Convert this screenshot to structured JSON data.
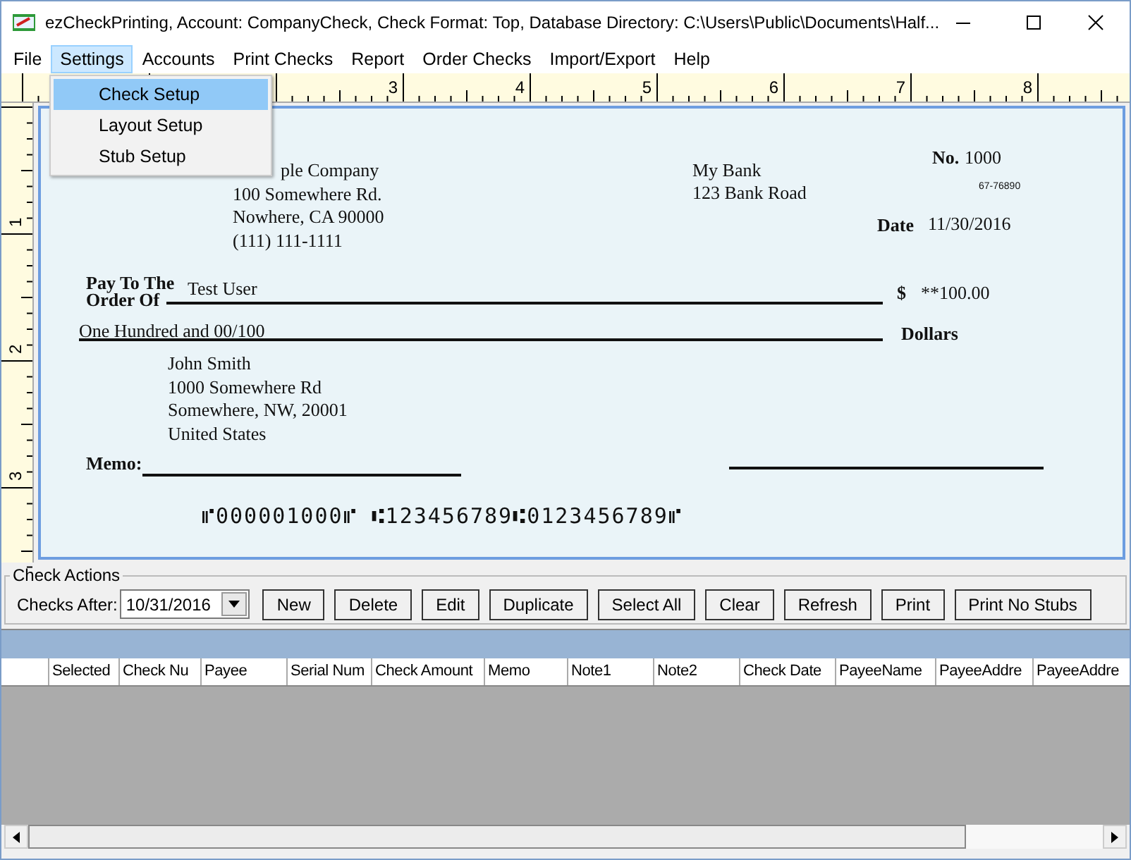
{
  "window": {
    "title": "ezCheckPrinting, Account: CompanyCheck, Check Format: Top, Database Directory: C:\\Users\\Public\\Documents\\Half..."
  },
  "menu": [
    {
      "label": "File",
      "selected": false
    },
    {
      "label": "Settings",
      "selected": true
    },
    {
      "label": "Accounts",
      "selected": false
    },
    {
      "label": "Print Checks",
      "selected": false
    },
    {
      "label": "Report",
      "selected": false
    },
    {
      "label": "Order Checks",
      "selected": false
    },
    {
      "label": "Import/Export",
      "selected": false
    },
    {
      "label": "Help",
      "selected": false
    }
  ],
  "settings_menu": [
    {
      "label": "Check Setup",
      "selected": true
    },
    {
      "label": "Layout Setup",
      "selected": false
    },
    {
      "label": "Stub Setup",
      "selected": false
    }
  ],
  "ruler": {
    "horizontal_labels": [
      "3",
      "4",
      "5",
      "6",
      "7",
      "8"
    ],
    "vertical_labels": [
      "1",
      "2",
      "3"
    ]
  },
  "check": {
    "company_lines": [
      "ple Company",
      "100 Somewhere Rd.",
      "Nowhere, CA 90000",
      "(111) 111-1111"
    ],
    "bank_lines": [
      "My Bank",
      "123 Bank Road"
    ],
    "number_label": "No.",
    "number": "1000",
    "routing": "67-76890",
    "date_label": "Date",
    "date": "11/30/2016",
    "pay_to_label": [
      "Pay To The",
      "Order Of"
    ],
    "payee": "Test User",
    "dollar_sign": "$",
    "amount": "**100.00",
    "amount_words": "One Hundred  and 00/100",
    "dollars_label": "Dollars",
    "address_lines": [
      "John Smith",
      "1000 Somewhere Rd",
      "Somewhere, NW, 20001",
      "United States"
    ],
    "memo_label": "Memo:",
    "micr": "⑈000001000⑈ ⑆123456789⑆0123456789⑈"
  },
  "check_actions": {
    "title": "Check Actions",
    "checks_after_label": "Checks After:",
    "checks_after": "10/31/2016",
    "buttons": [
      "New",
      "Delete",
      "Edit",
      "Duplicate",
      "Select All",
      "Clear",
      "Refresh",
      "Print",
      "Print No Stubs"
    ]
  },
  "table": {
    "columns": [
      "Selected",
      "Check Nu",
      "Payee",
      "Serial Num",
      "Check Amount",
      "Memo",
      "Note1",
      "Note2",
      "Check Date",
      "PayeeName",
      "PayeeAddre",
      "PayeeAddre"
    ]
  }
}
